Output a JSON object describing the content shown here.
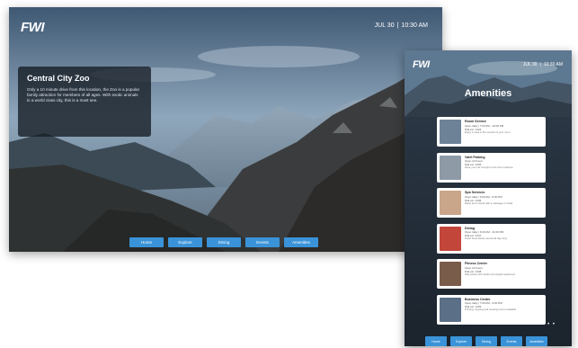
{
  "landscape": {
    "logo": "FWI",
    "date": "JUL 30",
    "time": "10:30 AM",
    "title": "Central City Zoo",
    "description": "Only a 10 minute drive from this location, the Zoo is a popular family attraction for members of all ages. With exotic animals in a world class city, this is a must see.",
    "nav": [
      "Home",
      "Explore",
      "Dining",
      "Events",
      "Amenities"
    ]
  },
  "portrait": {
    "logo": "FWI",
    "date": "JUL 30",
    "time": "10:30 AM",
    "heading": "Amenities",
    "cards": [
      {
        "name": "Room Service",
        "hours": "Open daily | 7:00 AM - 10:00 PM",
        "ext": "Dial ext. 1234",
        "desc": "Enjoy a meal in the comfort of your room."
      },
      {
        "name": "Valet Parking",
        "hours": "Open 24 hours",
        "ext": "Dial ext. 1235",
        "desc": "Have your car brought to the front entrance."
      },
      {
        "name": "Spa Services",
        "hours": "Open daily | 9:00 AM - 8:00 PM",
        "ext": "Dial ext. 1236",
        "desc": "Relax and unwind with a massage or facial."
      },
      {
        "name": "Dining",
        "hours": "Open daily | 6:00 AM - 11:00 PM",
        "ext": "Dial ext. 1237",
        "desc": "Fresh local dishes served all day long."
      },
      {
        "name": "Fitness Center",
        "hours": "Open 24 hours",
        "ext": "Dial ext. 1238",
        "desc": "Stay active with cardio and weight equipment."
      },
      {
        "name": "Business Center",
        "hours": "Open daily | 7:00 AM - 9:00 PM",
        "ext": "Dial ext. 1239",
        "desc": "Printing, copying and meeting rooms available."
      }
    ],
    "pager": "• • •",
    "nav": [
      "Home",
      "Explore",
      "Dining",
      "Events",
      "Amenities"
    ]
  },
  "colors": {
    "button": "#3a93d8",
    "overlay": "#161c24",
    "card_thumbs": [
      "#6d8296",
      "#8e9aa6",
      "#c9a58a",
      "#c2463a",
      "#7a5c4a",
      "#5b6f86"
    ]
  }
}
